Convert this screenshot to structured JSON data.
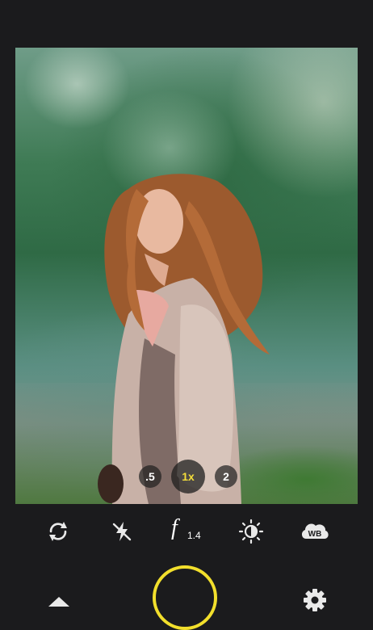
{
  "zoom": {
    "options": [
      ".5",
      "1x",
      "2"
    ],
    "selected": "1x"
  },
  "controls": {
    "switch_camera_icon": "rotate-arrows-icon",
    "flash_icon": "flash-off-icon",
    "aperture_symbol": "f",
    "aperture_value": "1.4",
    "exposure_icon": "brightness-icon",
    "white_balance_icon": "white-balance-icon",
    "white_balance_label": "WB"
  },
  "bottom": {
    "expand_icon": "triangle-up-icon",
    "settings_icon": "gear-icon"
  },
  "colors": {
    "accent": "#f2df2c",
    "background": "#1b1b1d",
    "icon": "#e9e9e9"
  }
}
